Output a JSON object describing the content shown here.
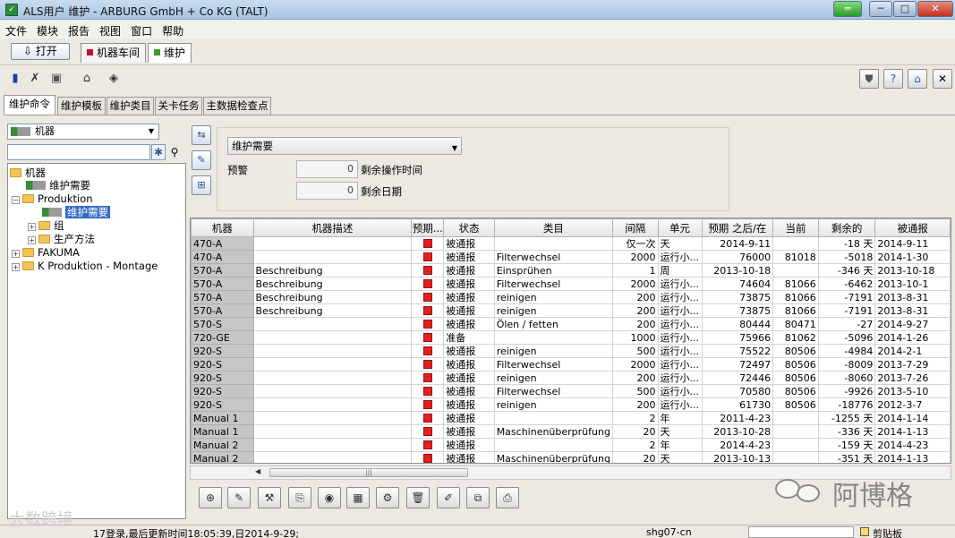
{
  "window": {
    "title": "ALS用户 维护 - ARBURG GmbH + Co KG (TALT)"
  },
  "menu": [
    "文件",
    "模块",
    "报告",
    "视图",
    "窗口",
    "帮助"
  ],
  "open_button": "打开",
  "doc_tabs": [
    {
      "label": "机器车间",
      "color": "#c8102e"
    },
    {
      "label": "维护",
      "color": "#3f9a2e"
    }
  ],
  "function_tabs": [
    "维护命令",
    "维护模板",
    "维护类目",
    "关卡任务",
    "主数据检查点"
  ],
  "left_panel": {
    "combo_value": "机器",
    "tree": {
      "root": "机器",
      "root_child": "维护需要",
      "produktion": "Produktion",
      "produktion_selected": "维护需要",
      "group": "组",
      "method": "生产方法",
      "fakuma": "FAKUMA",
      "k_produktion": "K Produktion - Montage"
    }
  },
  "filter": {
    "selected": "维护需要",
    "warning_label": "预警",
    "remaining_time_value": "0",
    "remaining_time_label": "剩余操作时间",
    "remaining_date_value": "0",
    "remaining_date_label": "剩余日期"
  },
  "table": {
    "columns": [
      "机器",
      "机器描述",
      "预期...",
      "状态",
      "类目",
      "间隔",
      "单元",
      "预期 之后/在",
      "当前",
      "剩余的",
      "被通报"
    ],
    "rows": [
      [
        "470-A",
        "",
        "",
        "被通报",
        "",
        "仅一次",
        "天",
        "2014-9-11",
        "",
        "-18 天",
        "2014-9-11"
      ],
      [
        "470-A",
        "",
        "",
        "被通报",
        "Filterwechsel",
        "2000",
        "运行小...",
        "76000",
        "81018",
        "-5018",
        "2014-1-30"
      ],
      [
        "570-A",
        "Beschreibung",
        "",
        "被通报",
        "Einsprühen",
        "1",
        "周",
        "2013-10-18",
        "",
        "-346 天",
        "2013-10-18"
      ],
      [
        "570-A",
        "Beschreibung",
        "",
        "被通报",
        "Filterwechsel",
        "2000",
        "运行小...",
        "74604",
        "81066",
        "-6462",
        "2013-10-1"
      ],
      [
        "570-A",
        "Beschreibung",
        "",
        "被通报",
        "reinigen",
        "200",
        "运行小...",
        "73875",
        "81066",
        "-7191",
        "2013-8-31"
      ],
      [
        "570-A",
        "Beschreibung",
        "",
        "被通报",
        "reinigen",
        "200",
        "运行小...",
        "73875",
        "81066",
        "-7191",
        "2013-8-31"
      ],
      [
        "570-S",
        "",
        "",
        "被通报",
        "Ölen / fetten",
        "200",
        "运行小...",
        "80444",
        "80471",
        "-27",
        "2014-9-27"
      ],
      [
        "720-GE",
        "",
        "",
        "准备",
        "",
        "1000",
        "运行小...",
        "75966",
        "81062",
        "-5096",
        "2014-1-26"
      ],
      [
        "920-S",
        "",
        "",
        "被通报",
        "reinigen",
        "500",
        "运行小...",
        "75522",
        "80506",
        "-4984",
        "2014-2-1"
      ],
      [
        "920-S",
        "",
        "",
        "被通报",
        "Filterwechsel",
        "2000",
        "运行小...",
        "72497",
        "80506",
        "-8009",
        "2013-7-29"
      ],
      [
        "920-S",
        "",
        "",
        "被通报",
        "reinigen",
        "200",
        "运行小...",
        "72446",
        "80506",
        "-8060",
        "2013-7-26"
      ],
      [
        "920-S",
        "",
        "",
        "被通报",
        "Filterwechsel",
        "500",
        "运行小...",
        "70580",
        "80506",
        "-9926",
        "2013-5-10"
      ],
      [
        "920-S",
        "",
        "",
        "被通报",
        "reinigen",
        "200",
        "运行小...",
        "61730",
        "80506",
        "-18776",
        "2012-3-7"
      ],
      [
        "Manual 1",
        "",
        "",
        "被通报",
        "",
        "2",
        "年",
        "2011-4-23",
        "",
        "-1255 天",
        "2014-1-14"
      ],
      [
        "Manual 1",
        "",
        "",
        "被通报",
        "Maschinenüberprüfung",
        "20",
        "天",
        "2013-10-28",
        "",
        "-336 天",
        "2014-1-13"
      ],
      [
        "Manual 2",
        "",
        "",
        "被通报",
        "",
        "2",
        "年",
        "2014-4-23",
        "",
        "-159 天",
        "2014-4-23"
      ],
      [
        "Manual 2",
        "",
        "",
        "被通报",
        "Maschinenüberprüfung",
        "20",
        "天",
        "2013-10-13",
        "",
        "-351 天",
        "2014-1-13"
      ]
    ]
  },
  "status_bar": {
    "text": "17登录,最后更新时间18:05:39,日2014-9-29;",
    "host": "shg07-cn",
    "clipboard": "剪贴板"
  },
  "watermarks": {
    "right": "阿博格",
    "left": "大数跨境"
  },
  "icons": {
    "app": "app-icon",
    "toolbar": [
      "blue-flag-icon",
      "wrench-x-icon",
      "machine-tool-icon",
      "home-up-icon",
      "diamond-arrows-icon"
    ],
    "right": [
      "shield-icon",
      "help-icon",
      "home-icon",
      "close-icon"
    ]
  }
}
